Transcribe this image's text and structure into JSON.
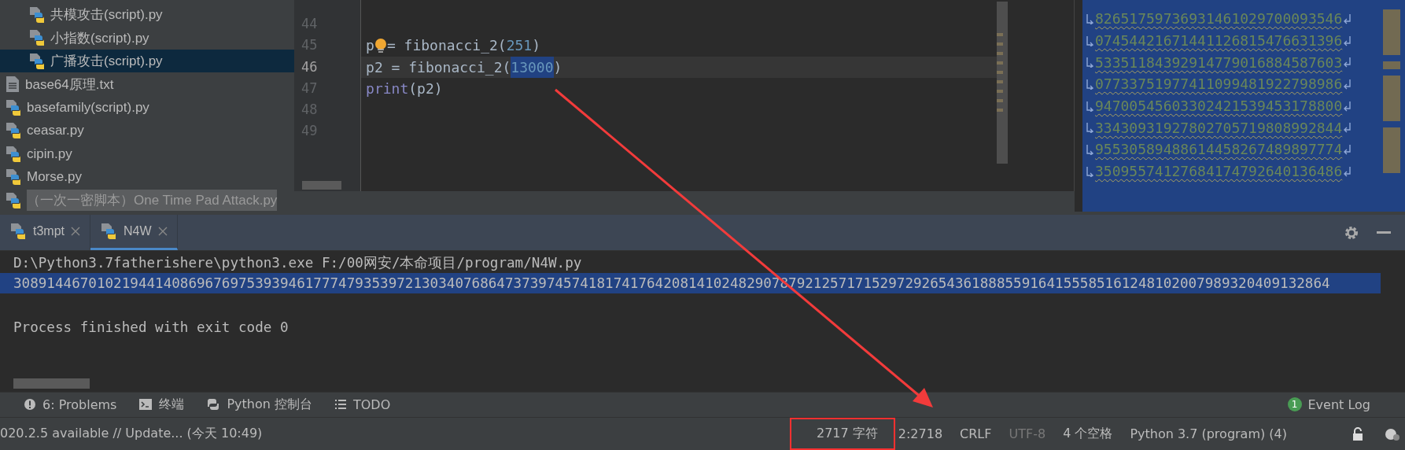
{
  "project_tree": {
    "items": [
      {
        "children": [
          {
            "label": "共模攻击(script).py",
            "kind": "python",
            "selected": false
          },
          {
            "label": "小指数(script).py",
            "kind": "python",
            "selected": false
          },
          {
            "label": "广播攻击(script).py",
            "kind": "python",
            "selected": true
          }
        ]
      },
      {
        "label": "base64原理.txt",
        "kind": "text",
        "selected": false
      },
      {
        "label": "basefamily(script).py",
        "kind": "python",
        "selected": false
      },
      {
        "label": "ceasar.py",
        "kind": "python",
        "selected": false
      },
      {
        "label": "cipin.py",
        "kind": "python",
        "selected": false
      },
      {
        "label": "Morse.py",
        "kind": "python",
        "selected": false
      },
      {
        "label": "（一次一密脚本）One Time Pad Attack.py",
        "kind": "python",
        "selected": false
      }
    ]
  },
  "editor": {
    "lines": [
      {
        "number": "44",
        "current": false
      },
      {
        "number": "45",
        "current": false,
        "tokens": [
          {
            "kind": "plain",
            "text": "p"
          },
          {
            "kind": "bulb"
          },
          {
            "kind": "plain",
            "text": "= fibonacci_2("
          },
          {
            "kind": "number",
            "text": "251",
            "selected": false
          },
          {
            "kind": "plain",
            "text": ")"
          }
        ]
      },
      {
        "number": "46",
        "current": true,
        "tokens": [
          {
            "kind": "plain",
            "text": "p2 = fibonacci_2("
          },
          {
            "kind": "number",
            "text": "13000",
            "selected": true
          },
          {
            "kind": "plain",
            "text": ")"
          }
        ]
      },
      {
        "number": "47",
        "current": false,
        "tokens": [
          {
            "kind": "builtin",
            "text": "print"
          },
          {
            "kind": "plain",
            "text": "(p2)"
          }
        ]
      },
      {
        "number": "48",
        "current": false
      },
      {
        "number": "49",
        "current": false
      }
    ]
  },
  "preview_panel": {
    "lines": [
      "82651759736931461029700093546",
      "07454421671441126815476631396",
      "53351184392914779016884587603",
      "07733751977411099481922798986",
      "94700545603302421539453178800",
      "33430931927802705719808992844",
      "95530589488614458267489897774",
      "35095574127684174792640136486"
    ]
  },
  "run_panel": {
    "tabs": [
      {
        "label": "t3mpt",
        "selected": false
      },
      {
        "label": "N4W",
        "selected": true
      }
    ],
    "output": [
      {
        "kind": "command",
        "text": "D:\\Python3.7fatherishere\\python3.exe F:/00网安/本命项目/program/N4W.py",
        "selected": false
      },
      {
        "kind": "result",
        "text": "30891446701021944140869676975393946177747935397213034076864737397457418174176420814102482907879212571715297292654361888559164155585161248102007989320409132864",
        "selected": true
      },
      {
        "kind": "status",
        "text": "Process finished with exit code 0",
        "selected": false
      }
    ]
  },
  "tool_windows": [
    {
      "kind": "problems",
      "label": "6: Problems"
    },
    {
      "kind": "terminal",
      "label": "终端"
    },
    {
      "kind": "console",
      "label": "Python 控制台"
    },
    {
      "kind": "todo",
      "label": "TODO"
    }
  ],
  "event_log": {
    "count": "1",
    "label": "Event Log"
  },
  "status_bar": {
    "message": "020.2.5 available // Update... (今天 10:49)",
    "items": [
      {
        "label": "2717 字符",
        "disabled": false,
        "highlighted": true
      },
      {
        "label": "2:2718",
        "disabled": false,
        "highlighted": false
      },
      {
        "label": "CRLF",
        "disabled": false,
        "highlighted": false
      },
      {
        "label": "UTF-8",
        "disabled": true,
        "highlighted": false
      },
      {
        "label": "4 个空格",
        "disabled": false,
        "highlighted": false
      },
      {
        "label": "Python 3.7 (program) (4)",
        "disabled": false,
        "highlighted": false
      }
    ]
  }
}
